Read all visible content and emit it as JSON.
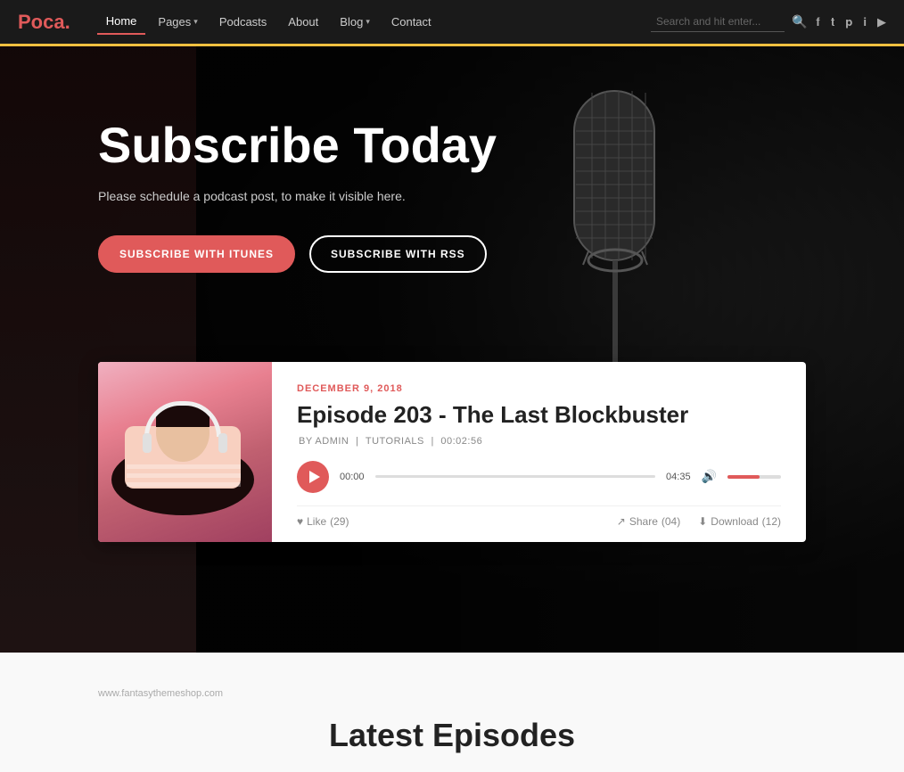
{
  "brand": {
    "name": "Poca",
    "dot": "."
  },
  "nav": {
    "items": [
      {
        "label": "Home",
        "active": true,
        "hasDropdown": false
      },
      {
        "label": "Pages",
        "active": false,
        "hasDropdown": true
      },
      {
        "label": "Podcasts",
        "active": false,
        "hasDropdown": false
      },
      {
        "label": "About",
        "active": false,
        "hasDropdown": false
      },
      {
        "label": "Blog",
        "active": false,
        "hasDropdown": true
      },
      {
        "label": "Contact",
        "active": false,
        "hasDropdown": false
      }
    ],
    "search": {
      "placeholder": "Search and hit enter..."
    }
  },
  "social": {
    "icons": [
      "f",
      "t",
      "p",
      "i",
      "y"
    ]
  },
  "hero": {
    "title": "Subscribe Today",
    "subtitle": "Please schedule a podcast post, to make it visible here.",
    "btn_itunes": "SUBSCRIBE WITH ITUNES",
    "btn_rss": "SUBSCRIBE WITH RSS"
  },
  "episode": {
    "date": "DECEMBER 9, 2018",
    "title": "Episode 203 - The Last Blockbuster",
    "author": "BY ADMIN",
    "category": "TUTORIALS",
    "duration": "00:02:56",
    "time_current": "00:00",
    "time_end": "04:35",
    "like_label": "Like",
    "like_count": "(29)",
    "share_label": "Share",
    "share_count": "(04)",
    "download_label": "Download",
    "download_count": "(12)"
  },
  "bottom": {
    "url": "www.fantasythemeshop.com",
    "latest_title": "Latest Episodes"
  }
}
